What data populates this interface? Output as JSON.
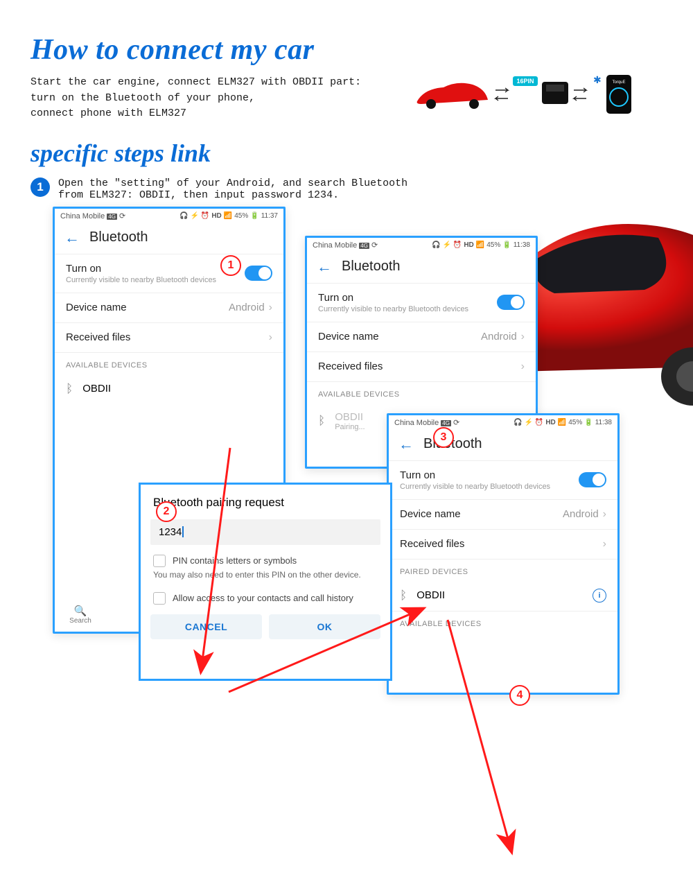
{
  "headings": {
    "main": "How to connect my car",
    "sub": "specific steps link"
  },
  "intro": "Start the car engine, connect ELM327 with OBDII part:\nturn on the Bluetooth of your phone,\nconnect phone with ELM327",
  "step1_num": "1",
  "step1_text": "Open the \"setting\" of your Android, and search Bluetooth\nfrom ELM327: OBDII, then input password 1234.",
  "topbar": {
    "pin_label": "16PIN",
    "bt_glyph": "✱",
    "phone_app": "TorquE"
  },
  "status": {
    "carrier": "China Mobile",
    "carrier_tag": "4G",
    "swirl": "⟳",
    "battery": "45%",
    "time1": "11:37",
    "time2": "11:38"
  },
  "bt": {
    "title": "Bluetooth",
    "turn_on": "Turn on",
    "visible": "Currently visible to nearby Bluetooth devices",
    "device_name_label": "Device name",
    "device_name_value": "Android",
    "received_files": "Received files",
    "available": "AVAILABLE DEVICES",
    "paired": "PAIRED DEVICES",
    "obdii": "OBDII",
    "pairing": "Pairing...",
    "search": "Search"
  },
  "dialog": {
    "title": "Bluetooth pairing request",
    "pin": "1234",
    "pin_letters": "PIN contains letters or symbols",
    "note": "You may also need to enter this PIN on the other device.",
    "allow": "Allow access to your contacts and call history",
    "cancel": "CANCEL",
    "ok": "OK"
  },
  "markers": {
    "m1": "1",
    "m2": "2",
    "m3": "3",
    "m4": "4"
  }
}
